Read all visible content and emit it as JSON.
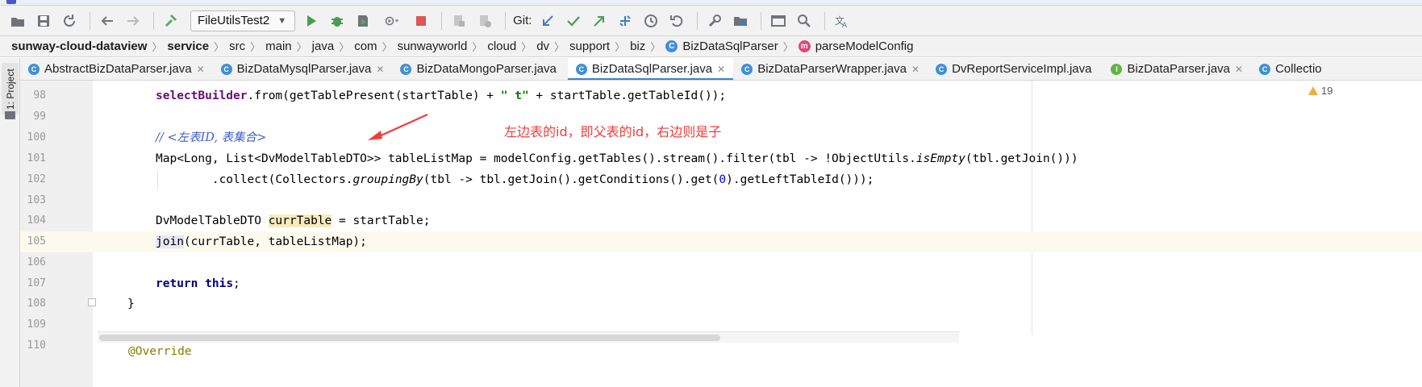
{
  "toolbar": {
    "run_config": "FileUtilsTest2",
    "git_label": "Git:",
    "icons": [
      "open-icon",
      "save-icon",
      "sync-icon",
      "back-icon",
      "forward-icon",
      "build-icon",
      "run-icon",
      "debug-icon",
      "coverage-icon",
      "profile-icon",
      "stop-icon",
      "attach-icon",
      "attach-debug-icon",
      "git-update-icon",
      "git-commit-icon",
      "git-push-icon",
      "git-pull-icon",
      "git-history-icon",
      "git-rollback-icon",
      "settings-icon",
      "project-structure-icon",
      "terminal-icon",
      "search-icon",
      "translate-icon"
    ]
  },
  "breadcrumb": [
    {
      "label": "sunway-cloud-dataview",
      "bold": true
    },
    {
      "label": "service",
      "bold": true
    },
    {
      "label": "src"
    },
    {
      "label": "main"
    },
    {
      "label": "java"
    },
    {
      "label": "com"
    },
    {
      "label": "sunwayworld"
    },
    {
      "label": "cloud"
    },
    {
      "label": "dv"
    },
    {
      "label": "support"
    },
    {
      "label": "biz"
    },
    {
      "label": "BizDataSqlParser",
      "icon": "C"
    },
    {
      "label": "parseModelConfig",
      "icon": "m"
    }
  ],
  "side": {
    "project_label": "1: Project"
  },
  "tabs": [
    {
      "label": "AbstractBizDataParser.java",
      "icon": "C",
      "closable": true
    },
    {
      "label": "BizDataMysqlParser.java",
      "icon": "C",
      "closable": true
    },
    {
      "label": "BizDataMongoParser.java",
      "icon": "C",
      "closable": false
    },
    {
      "label": "BizDataSqlParser.java",
      "icon": "C",
      "closable": true,
      "active": true
    },
    {
      "label": "BizDataParserWrapper.java",
      "icon": "C",
      "closable": true
    },
    {
      "label": "DvReportServiceImpl.java",
      "icon": "C",
      "closable": false
    },
    {
      "label": "BizDataParser.java",
      "icon": "I",
      "closable": true
    },
    {
      "label": "Collectio",
      "icon": "C",
      "closable": false
    }
  ],
  "editor": {
    "warnings_count": "19",
    "current_line": "105",
    "annotation": "左边表的id，即父表的id，右边则是子",
    "lines": [
      {
        "n": "98"
      },
      {
        "n": "99"
      },
      {
        "n": "100"
      },
      {
        "n": "101"
      },
      {
        "n": "102"
      },
      {
        "n": "103"
      },
      {
        "n": "104"
      },
      {
        "n": "105"
      },
      {
        "n": "106"
      },
      {
        "n": "107"
      },
      {
        "n": "108"
      },
      {
        "n": "109"
      },
      {
        "n": "110"
      }
    ],
    "code": {
      "l98_a": "selectBuilder",
      "l98_b": ".from(getTablePresent(startTable) + ",
      "l98_str": "\" t\"",
      "l98_c": " + startTable.getTableId());",
      "l100_cmt": "// <左表ID, 表集合>",
      "l101_a": "Map<Long, List<DvModelTableDTO>> tableListMap = modelConfig.getTables().stream().filter(tbl -> !ObjectUtils.",
      "l101_it": "isEmpty",
      "l101_b": "(tbl.getJoin()))",
      "l102_a": "        .collect(Collectors.",
      "l102_it": "groupingBy",
      "l102_b": "(tbl -> tbl.getJoin().getConditions().get(",
      "l102_num": "0",
      "l102_c": ").getLeftTableId()));",
      "l104_a": "DvModelTableDTO ",
      "l104_var": "currTable",
      "l104_b": " = startTable;",
      "l105_call": "join",
      "l105_b": "(currTable, tableListMap);",
      "l107_kw1": "return",
      "l107_kw2": "this",
      "l107_end": ";",
      "l108": "}",
      "l110": "@Override"
    }
  }
}
